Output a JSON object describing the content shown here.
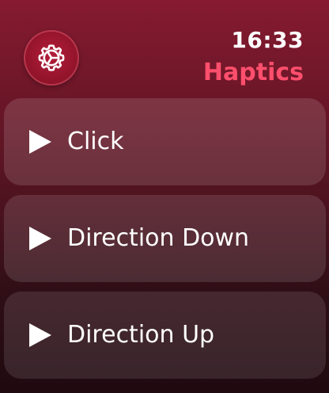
{
  "status": {
    "time": "16:33",
    "app_title": "Haptics"
  },
  "colors": {
    "accent": "#ff4f6d"
  },
  "settings_button": {
    "icon": "gear-icon"
  },
  "list": {
    "items": [
      {
        "label": "Click",
        "icon": "play-icon"
      },
      {
        "label": "Direction Down",
        "icon": "play-icon"
      },
      {
        "label": "Direction Up",
        "icon": "play-icon"
      }
    ]
  }
}
